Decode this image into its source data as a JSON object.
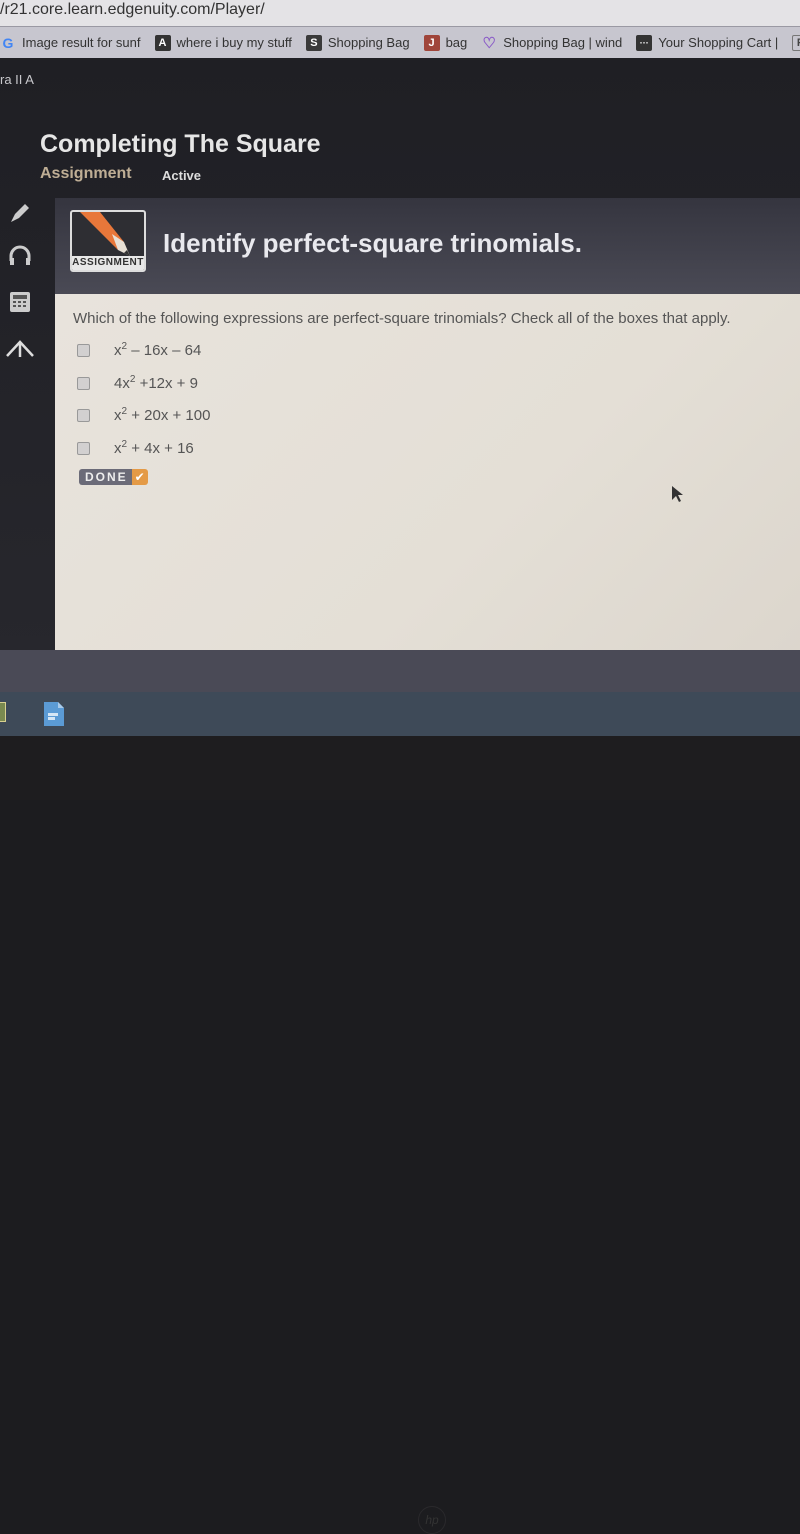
{
  "browser": {
    "url": "/r21.core.learn.edgenuity.com/Player/",
    "bookmarks": [
      {
        "icon": "google-icon",
        "glyph": "G",
        "label": "Image result for sunf",
        "color": "#4285f4"
      },
      {
        "icon": "a-site-icon",
        "glyph": "A",
        "label": "where i buy my stuff",
        "color": "#333333"
      },
      {
        "icon": "s-site-icon",
        "glyph": "S",
        "label": "Shopping Bag",
        "color": "#3a3a3a"
      },
      {
        "icon": "j-site-icon",
        "glyph": "J",
        "label": "bag",
        "color": "#a0453a"
      },
      {
        "icon": "heart-icon",
        "glyph": "♡",
        "label": "Shopping Bag | wind",
        "color": "#8a5bc7"
      },
      {
        "icon": "dots-site-icon",
        "glyph": "···",
        "label": "Your Shopping Cart |",
        "color": "#333333"
      },
      {
        "icon": "f-site-icon",
        "glyph": "F",
        "label": "",
        "color": "#555555"
      }
    ]
  },
  "app": {
    "course": "ra II A",
    "title": "Completing The Square",
    "type": "Assignment",
    "status": "Active",
    "badge_label": "ASSIGNMENT",
    "banner_title": "Identify perfect-square trinomials.",
    "question": "Which of the following expressions are perfect-square trinomials? Check all of the boxes that apply.",
    "choices": [
      {
        "pre": "x",
        "sup": "2",
        "post": " – 16x – 64",
        "checked": false
      },
      {
        "pre": "4x",
        "sup": "2",
        "post": " +12x + 9",
        "checked": false
      },
      {
        "pre": "x",
        "sup": "2",
        "post": " + 20x + 100",
        "checked": false
      },
      {
        "pre": "x",
        "sup": "2",
        "post": " + 4x + 16",
        "checked": false
      }
    ],
    "done_label": "DONE",
    "sidebar": [
      "pencil-icon",
      "headphones-icon",
      "calculator-icon",
      "graph-icon"
    ]
  },
  "footer": {
    "hp_logo": "hp"
  },
  "colors": {
    "accent_orange": "#e49a46",
    "assignment_tan": "#bfae95"
  }
}
